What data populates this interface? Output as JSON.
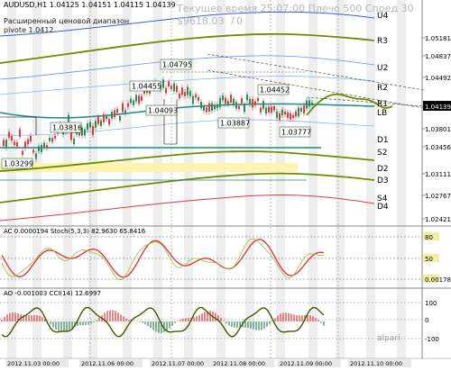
{
  "header": {
    "symbol_line": "AUDUSD,H1  1.04125 1.04151 1.04115 1.04139",
    "subtitle_1": "Расширенный ценовой диапазон",
    "subtitle_2": "pivote 1.0412",
    "server_time": "Текущее время 25:07:00 Плечо 500 Спред 30",
    "equity": "$9618.03",
    "slash": "/",
    "zero": "0"
  },
  "price_axis": {
    "ticks": [
      {
        "v": "1.05181"
      },
      {
        "v": "1.04837"
      },
      {
        "v": "1.04492"
      },
      {
        "v": "1.04139",
        "current": true
      },
      {
        "v": "1.03801"
      },
      {
        "v": "1.03456"
      },
      {
        "v": "1.03111"
      },
      {
        "v": "1.02767"
      },
      {
        "v": "1.02421"
      }
    ],
    "current_price": "1.04139"
  },
  "levels": {
    "labels": [
      "U4",
      "R3",
      "U2",
      "R2",
      "R1",
      "LB",
      "D1",
      "S2",
      "D2",
      "D3",
      "S4",
      "D4"
    ]
  },
  "price_labels": {
    "l1": "1.03299",
    "l2": "1.03816",
    "l3": "1.04093",
    "l4": "1.04455",
    "l5": "1.04795",
    "l6": "1.03887",
    "l7": "1.04452",
    "l8": "1.03777"
  },
  "stoch": {
    "label": "AC 0.0000194  Stoch(5,3,3) 82.9630 65.8416",
    "ticks": [
      "80",
      "50",
      "0.00178"
    ]
  },
  "cci": {
    "label": "AO -0.001003  CCI(14) 12.6997",
    "ticks": [
      "100",
      "0",
      "-100"
    ]
  },
  "time_axis": {
    "labels": [
      "2012.11.03 00:00",
      "2012.11.06 00:00",
      "2012.11.07 00:00",
      "2012.11.08 00:00",
      "2012.11.09 00:00",
      "2012.11.10 00:00"
    ]
  },
  "brand": "alpari",
  "colors": {
    "green_line": "#6b8e00",
    "teal_line": "#1c8a8a",
    "blue_line": "#3b5bdb",
    "red_line": "#e03a3a",
    "bull": "#2e8b57",
    "bear": "#e03a3a",
    "shade": "#eeeeee",
    "highlight": "#fff3b0"
  }
}
